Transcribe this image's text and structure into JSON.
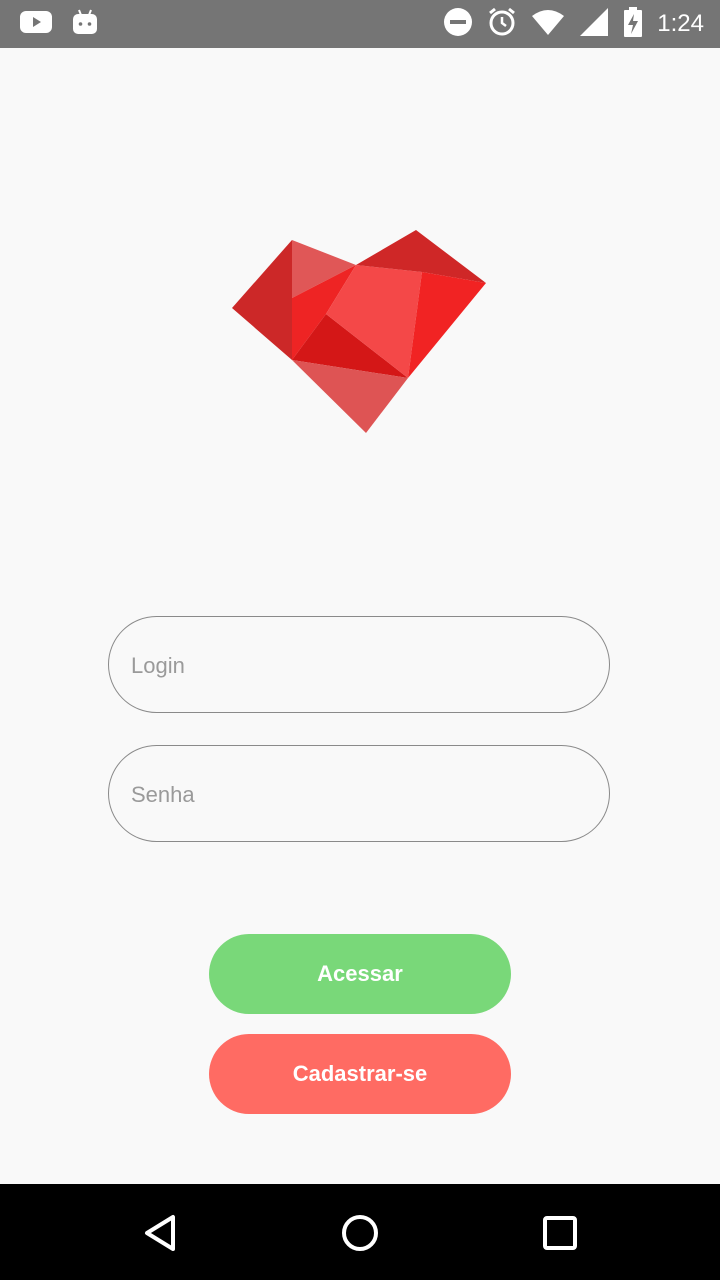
{
  "status_bar": {
    "time": "1:24",
    "left_icons": [
      "youtube-icon",
      "android-icon"
    ],
    "right_icons": [
      "do-not-disturb-icon",
      "alarm-icon",
      "wifi-icon",
      "signal-icon",
      "battery-icon"
    ]
  },
  "login_form": {
    "login_placeholder": "Login",
    "password_placeholder": "Senha"
  },
  "buttons": {
    "access_label": "Acessar",
    "register_label": "Cadastrar-se"
  },
  "colors": {
    "access_button": "#79d879",
    "register_button": "#ff6b63",
    "logo_red": "#e02020",
    "status_bar": "#757575"
  },
  "nav_bar": {
    "icons": [
      "back-icon",
      "home-icon",
      "recents-icon"
    ]
  }
}
